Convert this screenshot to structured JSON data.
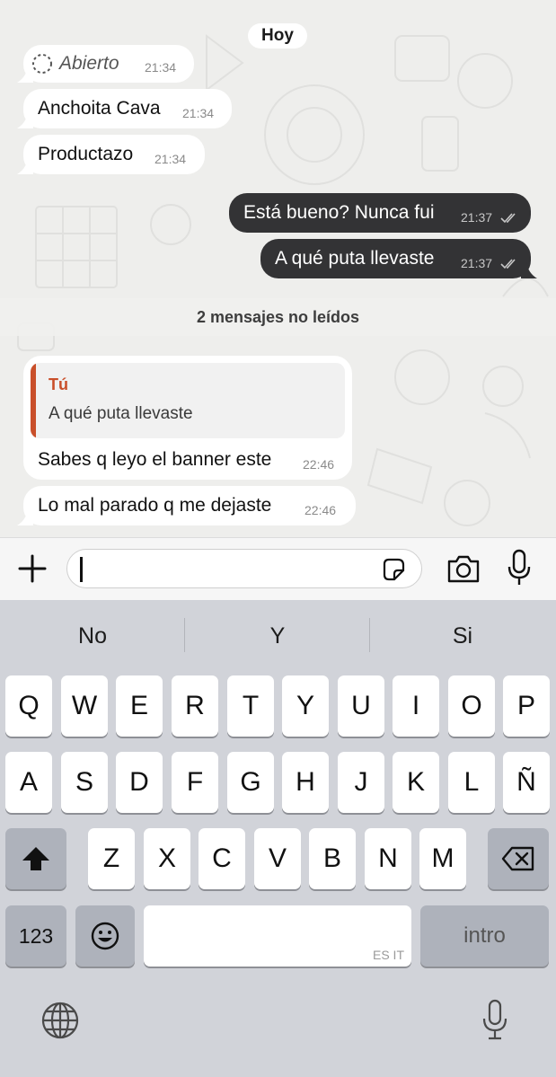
{
  "chat": {
    "date_chip": "Hoy",
    "messages": [
      {
        "text": "Abierto",
        "time": "21:34"
      },
      {
        "text": "Anchoita Cava",
        "time": "21:34"
      },
      {
        "text": "Productazo",
        "time": "21:34"
      },
      {
        "text": "Está bueno? Nunca fui",
        "time": "21:37"
      },
      {
        "text": "A qué puta llevaste",
        "time": "21:37"
      },
      {
        "quote_author": "Tú",
        "quote_text": "A qué puta llevaste",
        "text": "Sabes q leyo el banner este",
        "time": "22:46"
      },
      {
        "text": "Lo mal parado q me dejaste",
        "time": "22:46"
      }
    ],
    "unread_banner": "2 mensajes no leídos"
  },
  "composer": {
    "input_value": "",
    "icons": [
      "plus-icon",
      "sticker-icon",
      "camera-icon",
      "microphone-icon"
    ]
  },
  "keyboard": {
    "suggestions": [
      "No",
      "Y",
      "Si"
    ],
    "row1": [
      "Q",
      "W",
      "E",
      "R",
      "T",
      "Y",
      "U",
      "I",
      "O",
      "P"
    ],
    "row2": [
      "A",
      "S",
      "D",
      "F",
      "G",
      "H",
      "J",
      "K",
      "L",
      "Ñ"
    ],
    "row3": [
      "Z",
      "X",
      "C",
      "V",
      "B",
      "N",
      "M"
    ],
    "numbers_key": "123",
    "space_lang": "ES IT",
    "return_key": "intro",
    "icons": [
      "shift-icon",
      "backspace-icon",
      "emoji-icon",
      "globe-icon",
      "dictation-mic-icon"
    ]
  },
  "colors": {
    "chat_bg": "#eeeeec",
    "outgoing_bubble": "#333335",
    "incoming_bubble": "#ffffff",
    "quote_accent": "#c94f2a",
    "keyboard_bg": "#d1d3d9"
  }
}
